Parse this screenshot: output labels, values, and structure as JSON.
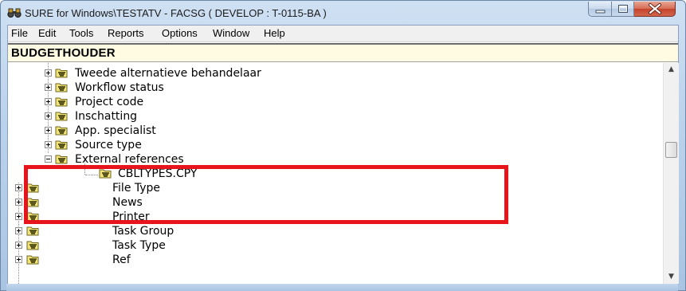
{
  "window": {
    "title": "SURE for Windows\\TESTATV - FACSG ( DEVELOP : T-0115-BA )",
    "app_icon": "binoculars-icon",
    "controls": [
      "minimize-icon",
      "maximize-icon",
      "close-icon"
    ]
  },
  "menubar": {
    "items": [
      "File",
      "Edit",
      "Tools",
      "Reports",
      "Options",
      "Window",
      "Help"
    ]
  },
  "header": {
    "title": "BUDGETHOUDER"
  },
  "tree": {
    "nodes": [
      {
        "label": "Tweede alternatieve behandelaar",
        "expander": "plus",
        "icon": "folder-icon"
      },
      {
        "label": "Workflow status",
        "expander": "plus",
        "icon": "folder-icon"
      },
      {
        "label": "Project code",
        "expander": "plus",
        "icon": "folder-icon"
      },
      {
        "label": "Inschatting",
        "expander": "plus",
        "icon": "folder-icon"
      },
      {
        "label": "App. specialist",
        "expander": "plus",
        "icon": "folder-icon"
      },
      {
        "label": "Source type",
        "expander": "plus",
        "icon": "folder-icon"
      },
      {
        "label": "External references",
        "expander": "minus",
        "icon": "folder-icon"
      },
      {
        "label": "CBLTYPES.CPY",
        "expander": "none",
        "icon": "folder-icon"
      },
      {
        "label": "File Type",
        "expander": "plus",
        "icon": "folder-icon"
      },
      {
        "label": "News",
        "expander": "plus",
        "icon": "folder-icon"
      },
      {
        "label": "Printer",
        "expander": "plus",
        "icon": "folder-icon"
      },
      {
        "label": "Task Group",
        "expander": "plus",
        "icon": "folder-icon"
      },
      {
        "label": "Task Type",
        "expander": "plus",
        "icon": "folder-icon"
      },
      {
        "label": "Ref",
        "expander": "plus",
        "icon": "folder-icon"
      }
    ]
  },
  "annotation": {
    "color": "#e8141b"
  },
  "colors": {
    "header_bg": "#fffbe3",
    "title_gradient": "#bcd3ec",
    "close_button": "#c4432a"
  }
}
